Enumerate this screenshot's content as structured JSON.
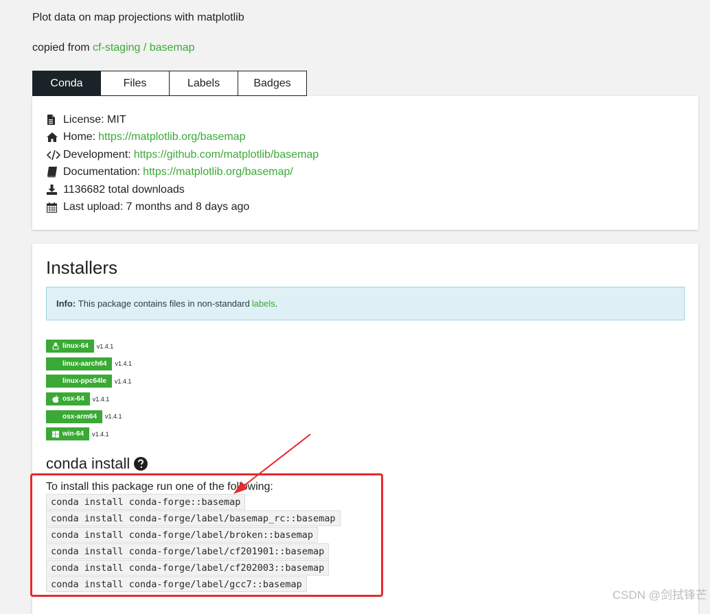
{
  "summary": "Plot data on map projections with matplotlib",
  "copied": {
    "prefix": "copied from",
    "link": "cf-staging / basemap"
  },
  "tabs": [
    {
      "label": "Conda"
    },
    {
      "label": "Files"
    },
    {
      "label": "Labels"
    },
    {
      "label": "Badges"
    }
  ],
  "meta": {
    "license": "License: MIT",
    "home_label": "Home:",
    "home_url": "https://matplotlib.org/basemap",
    "dev_label": "Development:",
    "dev_url": "https://github.com/matplotlib/basemap",
    "docs_label": "Documentation:",
    "docs_url": "https://matplotlib.org/basemap/",
    "downloads": "1136682 total downloads",
    "upload": "Last upload: 7 months and 8 days ago"
  },
  "installers": {
    "title": "Installers",
    "alert_bold": "Info:",
    "alert_text": "This package contains files in non-standard",
    "alert_link": "labels",
    "alert_end": ".",
    "platforms": [
      {
        "label": "linux-64",
        "icon": "linux-icon",
        "version": "v1.4.1"
      },
      {
        "label": "linux-aarch64",
        "icon": "",
        "version": "v1.4.1"
      },
      {
        "label": "linux-ppc64le",
        "icon": "",
        "version": "v1.4.1"
      },
      {
        "label": "osx-64",
        "icon": "apple-icon",
        "version": "v1.4.1"
      },
      {
        "label": "osx-arm64",
        "icon": "",
        "version": "v1.4.1"
      },
      {
        "label": "win-64",
        "icon": "windows-icon",
        "version": "v1.4.1"
      }
    ]
  },
  "conda_install": {
    "title": "conda install",
    "intro": "To install this package run one of the following:",
    "commands": [
      "conda install conda-forge::basemap",
      "conda install conda-forge/label/basemap_rc::basemap",
      "conda install conda-forge/label/broken::basemap",
      "conda install conda-forge/label/cf201901::basemap",
      "conda install conda-forge/label/cf202003::basemap",
      "conda install conda-forge/label/gcc7::basemap"
    ]
  },
  "watermark": "CSDN @剑拭锋芒",
  "colors": {
    "accent": "#3aa935",
    "annotation": "#e8282c",
    "tab_active": "#1a2327"
  }
}
